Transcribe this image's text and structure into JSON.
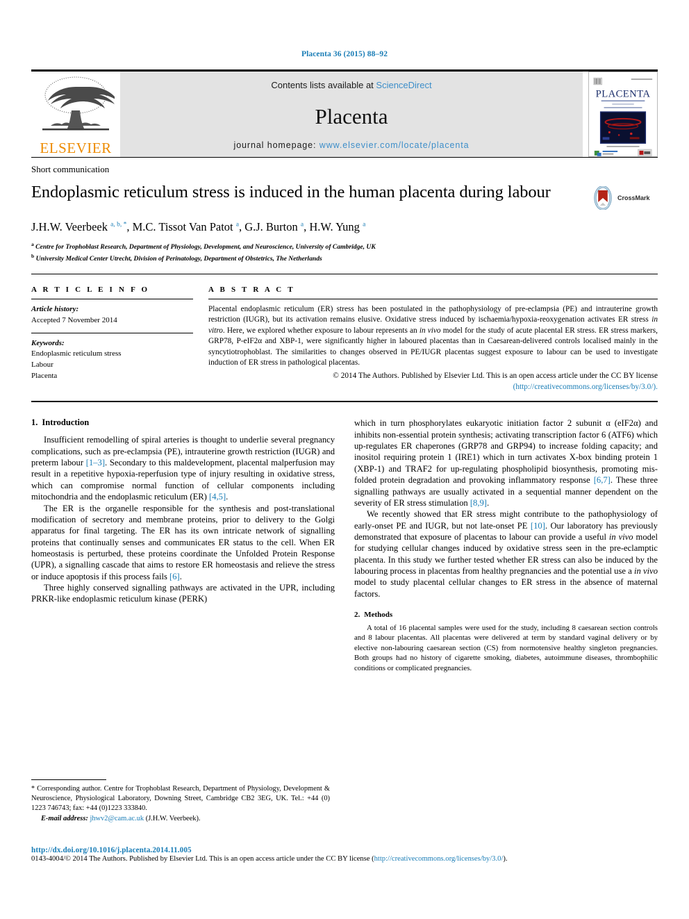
{
  "running_head": "Placenta 36 (2015) 88–92",
  "masthead": {
    "publisher_logo_text": "ELSEVIER",
    "contents_prefix": "Contents lists available at ",
    "contents_link": "ScienceDirect",
    "journal_title": "Placenta",
    "homepage_prefix": "journal homepage: ",
    "homepage_url": "www.elsevier.com/locate/placenta",
    "cover_title": "PLACENTA",
    "link_color": "#3d8ec9",
    "banner_bg": "#e3e3e3",
    "elsevier_orange": "#ED8B00"
  },
  "article": {
    "type": "Short communication",
    "title": "Endoplasmic reticulum stress is induced in the human placenta during labour",
    "crossmark_label": "CrossMark",
    "authors_html": "J.H.W. Veerbeek <sup>a, b, *</sup>, M.C. Tissot Van Patot <sup>a</sup>, G.J. Burton <sup>a</sup>, H.W. Yung <sup>a</sup>",
    "affiliations": [
      {
        "marker": "a",
        "text": "Centre for Trophoblast Research, Department of Physiology, Development, and Neuroscience, University of Cambridge, UK"
      },
      {
        "marker": "b",
        "text": "University Medical Center Utrecht, Division of Perinatology, Department of Obstetrics, The Netherlands"
      }
    ]
  },
  "article_info": {
    "heading": "A R T I C L E   I N F O",
    "history_label": "Article history:",
    "history_value": "Accepted 7 November 2014",
    "keywords_label": "Keywords:",
    "keywords": [
      "Endoplasmic reticulum stress",
      "Labour",
      "Placenta"
    ]
  },
  "abstract": {
    "heading": "A B S T R A C T",
    "body_html": "Placental endoplasmic reticulum (ER) stress has been postulated in the pathophysiology of pre-eclampsia (PE) and intrauterine growth restriction (IUGR), but its activation remains elusive. Oxidative stress induced by ischaemia/hypoxia-reoxygenation activates ER stress <i>in vitro</i>. Here, we explored whether exposure to labour represents an <i>in vivo</i> model for the study of acute placental ER stress. ER stress markers, GRP78, P-eIF2&alpha; and XBP-1, were significantly higher in laboured placentas than in Caesarean-delivered controls localised mainly in the syncytiotrophoblast. The similarities to changes observed in PE/IUGR placentas suggest exposure to labour can be used to investigate induction of ER stress in pathological placentas.",
    "copyright_html": "&copy; 2014 The Authors. Published by Elsevier Ltd. This is an open access article under the CC BY license",
    "license_url": "(http://creativecommons.org/licenses/by/3.0/)."
  },
  "sections": {
    "intro": {
      "number": "1.",
      "title": "Introduction",
      "paragraphs_html": [
        "Insufficient remodelling of spiral arteries is thought to underlie several pregnancy complications, such as pre-eclampsia (PE), intrauterine growth restriction (IUGR) and preterm labour <span class=\"ref\">[1&ndash;3]</span>. Secondary to this maldevelopment, placental malperfusion may result in a repetitive hypoxia-reperfusion type of injury resulting in oxidative stress, which can compromise normal function of cellular components including mitochondria and the endoplasmic reticulum (ER) <span class=\"ref\">[4,5]</span>.",
        "The ER is the organelle responsible for the synthesis and post-translational modification of secretory and membrane proteins, prior to delivery to the Golgi apparatus for final targeting. The ER has its own intricate network of signalling proteins that continually senses and communicates ER status to the cell. When ER homeostasis is perturbed, these proteins coordinate the Unfolded Protein Response (UPR), a signalling cascade that aims to restore ER homeostasis and relieve the stress or induce apoptosis if this process fails <span class=\"ref\">[6]</span>.",
        "Three highly conserved signalling pathways are activated in the UPR, including PRKR-like endoplasmic reticulum kinase (PERK)",
        "which in turn phosphorylates eukaryotic initiation factor 2 subunit &alpha; (eIF2&alpha;) and inhibits non-essential protein synthesis; activating transcription factor 6 (ATF6) which up-regulates ER chaperones (GRP78 and GRP94) to increase folding capacity; and inositol requiring protein 1 (IRE1) which in turn activates X-box binding protein 1 (XBP-1) and TRAF2 for up-regulating phospholipid biosynthesis, promoting mis-folded protein degradation and provoking inflammatory response <span class=\"ref\">[6,7]</span>. These three signalling pathways are usually activated in a sequential manner dependent on the severity of ER stress stimulation <span class=\"ref\">[8,9]</span>.",
        "We recently showed that ER stress might contribute to the pathophysiology of early-onset PE and IUGR, but not late-onset PE <span class=\"ref\">[10]</span>. Our laboratory has previously demonstrated that exposure of placentas to labour can provide a useful <i>in vivo</i> model for studying cellular changes induced by oxidative stress seen in the pre-eclamptic placenta. In this study we further tested whether ER stress can also be induced by the labouring process in placentas from healthy pregnancies and the potential use a <i>in vivo</i> model to study placental cellular changes to ER stress in the absence of maternal factors."
      ]
    },
    "methods": {
      "number": "2.",
      "title": "Methods",
      "paragraphs_html": [
        "A total of 16 placental samples were used for the study, including 8 caesarean section controls and 8 labour placentas. All placentas were delivered at term by standard vaginal delivery or by elective non-labouring caesarean section (CS) from normotensive healthy singleton pregnancies. Both groups had no history of cigarette smoking, diabetes, autoimmune diseases, thrombophilic conditions or complicated pregnancies."
      ]
    }
  },
  "footnote": {
    "marker": "*",
    "text": "Corresponding author. Centre for Trophoblast Research, Department of Physiology, Development & Neuroscience, Physiological Laboratory, Downing Street, Cambridge CB2 3EG, UK. Tel.: +44 (0) 1223 746743; fax: +44 (0)1223 333840.",
    "email_label": "E-mail address:",
    "email": "jhwv2@cam.ac.uk",
    "email_owner": "(J.H.W. Veerbeek)."
  },
  "page_footer": {
    "doi": "http://dx.doi.org/10.1016/j.placenta.2014.11.005",
    "copyright_prefix": "0143-4004/© 2014 The Authors. Published by Elsevier Ltd. This is an open access article under the CC BY license (",
    "license_link": "http://creativecommons.org/licenses/by/3.0/",
    "copyright_suffix": ")."
  }
}
